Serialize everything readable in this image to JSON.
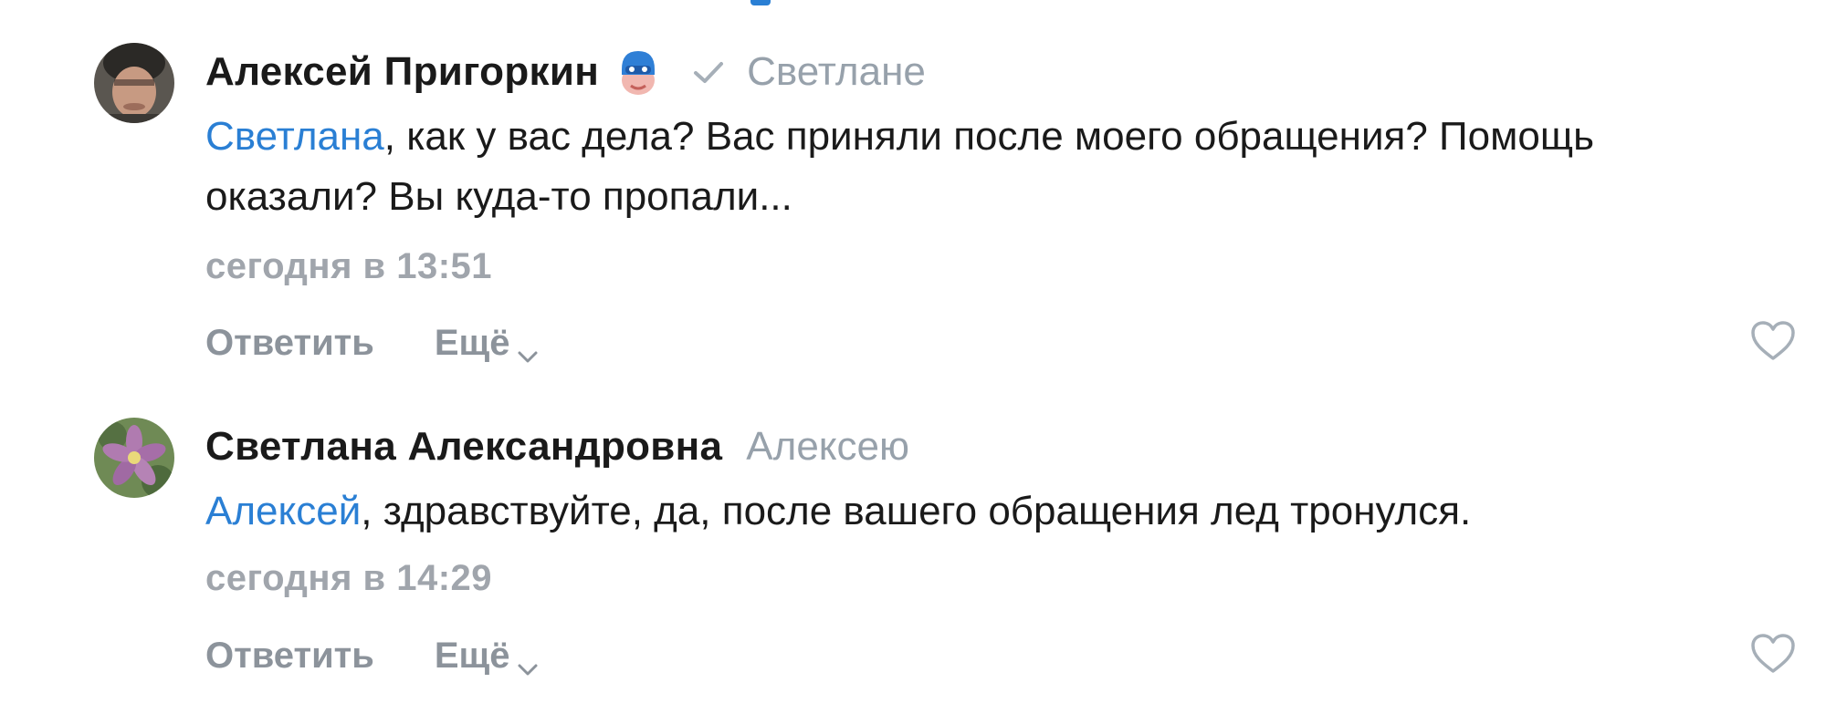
{
  "comments": [
    {
      "author": "Алексей Пригоркин",
      "badge_icon": "sticker-superhero-icon",
      "reply_to": "Светлане",
      "mention": "Светлана",
      "text": ", как у вас дела? Вас приняли после моего обращения? Помощь оказали? Вы куда-то пропали...",
      "time": "сегодня в 13:51",
      "reply_label": "Ответить",
      "more_label": "Ещё"
    },
    {
      "author": "Светлана Александровна",
      "reply_to": "Алексею",
      "mention": "Алексей",
      "text": ", здравствуйте, да, после вашего обращения лед тронулся.",
      "time": "сегодня в 14:29",
      "reply_label": "Ответить",
      "more_label": "Ещё"
    }
  ],
  "colors": {
    "link": "#2a7fd4",
    "text": "#1a1a1a",
    "muted": "#97a1ab"
  }
}
